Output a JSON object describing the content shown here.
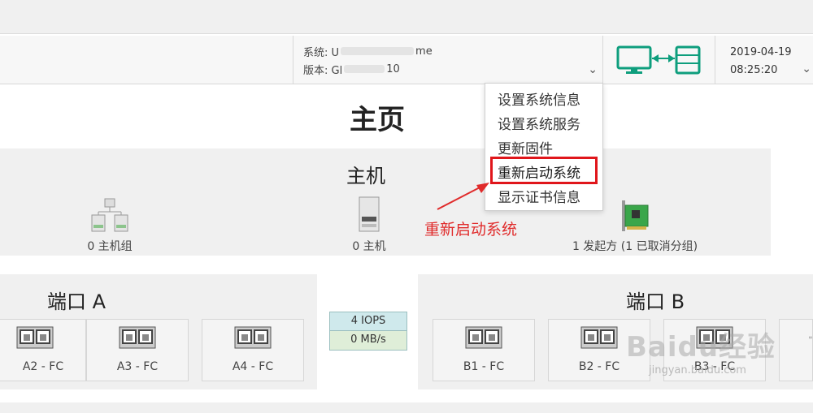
{
  "header": {
    "system_label": "系统: U",
    "system_suffix": "me",
    "version_label": "版本: Gl",
    "version_suffix": "10",
    "date": "2019-04-19",
    "time": "08:25:20",
    "chevron": "⌄"
  },
  "page": {
    "title": "主页"
  },
  "menu": {
    "items": [
      "设置系统信息",
      "设置系统服务",
      "更新固件",
      "重新启动系统",
      "显示证书信息"
    ]
  },
  "annotation": {
    "text": "重新启动系统",
    "color": "#e02b2b"
  },
  "host_panel": {
    "title": "主机",
    "host_groups": "0 主机组",
    "hosts": "0 主机",
    "initiators": "1 发起方 (1 已取消分组)"
  },
  "port_a": {
    "title": "端口 A",
    "ports": [
      "A2 - FC",
      "A3 - FC",
      "A4 - FC"
    ]
  },
  "port_b": {
    "title": "端口 B",
    "ports": [
      "B1 - FC",
      "B2 - FC",
      "B3 - FC"
    ]
  },
  "stats": {
    "iops": "4 IOPS",
    "throughput": "0 MB/s"
  },
  "watermark": {
    "brand": "Baidu经验",
    "url": "jingyan.baidu.com"
  },
  "colors": {
    "accent_green": "#0e9e7d",
    "highlight_red": "#e0161b"
  }
}
